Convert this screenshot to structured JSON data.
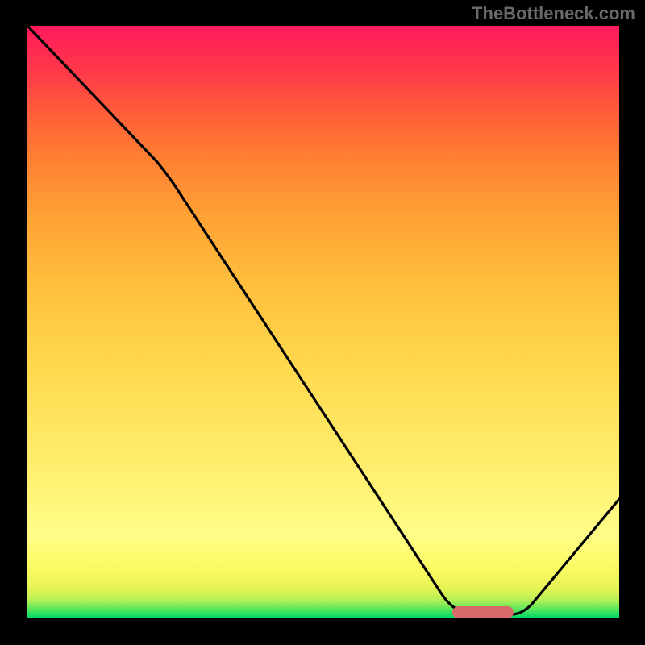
{
  "watermark": "TheBottleneck.com",
  "colors": {
    "background": "#000000",
    "curve": "#000000",
    "marker": "#d96a6a",
    "watermark": "#696969"
  },
  "chart_data": {
    "type": "line",
    "title": "",
    "xlabel": "",
    "ylabel": "",
    "xlim": [
      0,
      100
    ],
    "ylim": [
      0,
      100
    ],
    "series": [
      {
        "name": "curve",
        "x": [
          0,
          22,
          70,
          74,
          82,
          100
        ],
        "y": [
          100,
          77,
          4,
          0,
          0.5,
          20
        ]
      }
    ],
    "annotations": [
      {
        "type": "marker-bar",
        "x_start": 72,
        "x_end": 82,
        "y": 0.6,
        "color": "#d96a6a"
      }
    ],
    "gradient_stops": [
      {
        "pos": 0,
        "color": "#00d866"
      },
      {
        "pos": 14,
        "color": "#fffd88"
      },
      {
        "pos": 50,
        "color": "#ffcc45"
      },
      {
        "pos": 100,
        "color": "#ff1b5e"
      }
    ]
  }
}
